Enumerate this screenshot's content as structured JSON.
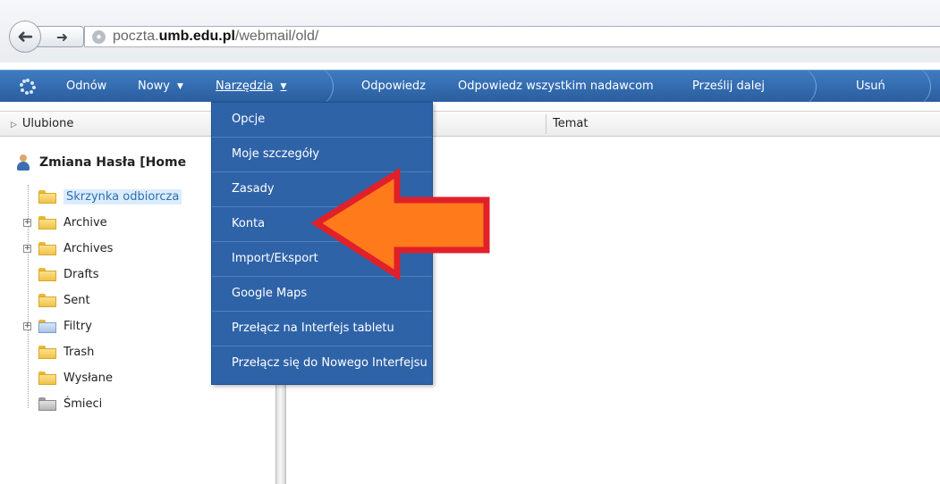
{
  "browser": {
    "url_host": "poczta.",
    "url_domain": "umb.edu.pl",
    "url_path": "/webmail/old/"
  },
  "toolbar": {
    "refresh_label": "Odnów",
    "new_label": "Nowy",
    "tools_label": "Narzędzia",
    "reply_label": "Odpowiedz",
    "reply_all_label": "Odpowiedz wszystkim nadawcom",
    "forward_label": "Prześlij dalej",
    "delete_label": "Usuń",
    "color": "#2f63a8"
  },
  "left_panel": {
    "favorites_label": "Ulubione",
    "account_label": "Zmiana Hasła [Home",
    "folders": [
      {
        "label": "Skrzynka odbiorcza",
        "expandable": false,
        "selected": true
      },
      {
        "label": "Archive",
        "expandable": true
      },
      {
        "label": "Archives",
        "expandable": true
      },
      {
        "label": "Drafts",
        "expandable": false
      },
      {
        "label": "Sent",
        "expandable": false
      },
      {
        "label": "Filtry",
        "expandable": true
      },
      {
        "label": "Trash",
        "expandable": false
      },
      {
        "label": "Wysłane",
        "expandable": false
      },
      {
        "label": "Śmieci",
        "expandable": false
      }
    ]
  },
  "message_list": {
    "subject_header": "Temat"
  },
  "tools_menu": {
    "items": [
      "Opcje",
      "Moje szczegóły",
      "Zasady",
      "Konta",
      "Import/Eksport",
      "Google Maps",
      "Przełącz na Interfejs tabletu",
      "Przełącz się do Nowego Interfejsu"
    ],
    "highlighted": "Konta"
  },
  "annotation": {
    "arrow_color": "#ff7a1a",
    "arrow_outline": "#e0202a"
  }
}
